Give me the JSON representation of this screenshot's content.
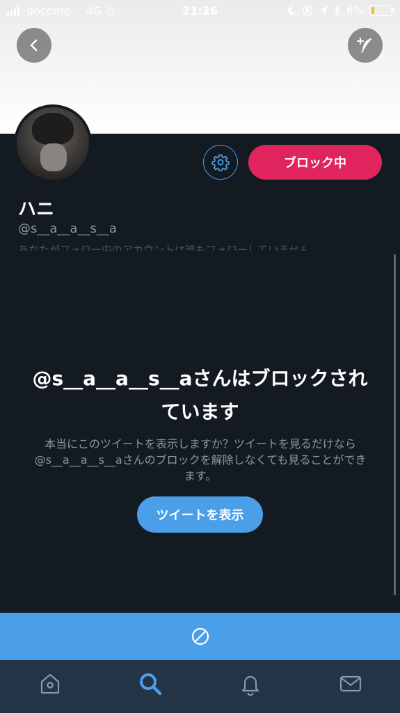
{
  "status_bar": {
    "carrier": "docomo",
    "network": "4G",
    "time": "21:26",
    "battery": "6%"
  },
  "profile": {
    "display_name": "ハニ",
    "handle": "@s__a__a__s__a",
    "follow_note": "あなたがフォロー中のアカウントは誰もフォローしていません",
    "block_button_label": "ブロック中"
  },
  "blocked": {
    "title": "@s__a__a__s__aさんはブロックされています",
    "description": "本当にこのツイートを表示しますか？ツイートを見るだけなら@s__a__a__s__aさんのブロックを解除しなくても見ることができます。",
    "show_button_label": "ツイートを表示"
  },
  "tabs": [
    "home-icon",
    "search-icon",
    "bell-icon",
    "envelope-icon"
  ],
  "colors": {
    "background": "#141a21",
    "accent_blue": "#4b9fe8",
    "block_red": "#e0245e",
    "tabbar": "#243447",
    "secondary_text": "#8899a6"
  }
}
